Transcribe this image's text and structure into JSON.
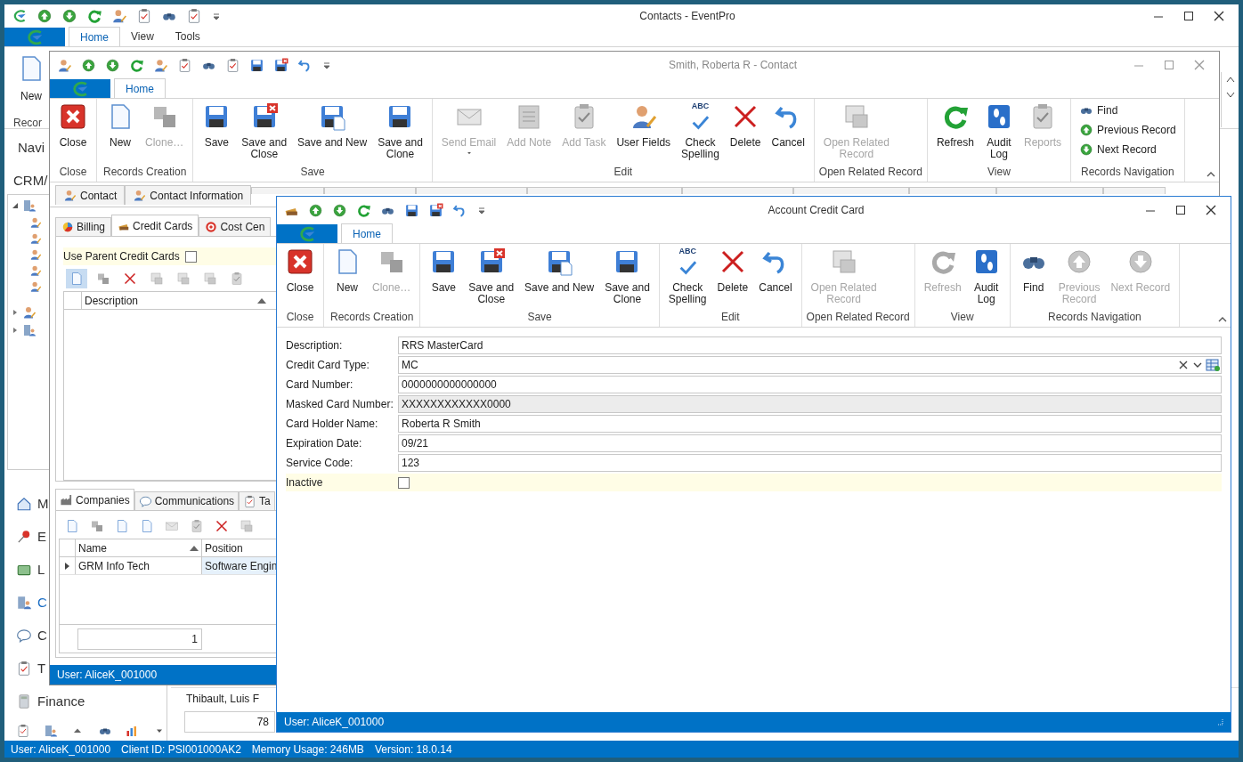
{
  "main": {
    "title": "Contacts - EventPro",
    "tabs": [
      {
        "label": "Home",
        "selected": true
      },
      {
        "label": "View",
        "selected": false
      },
      {
        "label": "Tools",
        "selected": false
      }
    ],
    "ribbon": {
      "button": "New",
      "group": "Recor"
    },
    "nav": {
      "title": "Navi",
      "section": "CRM/",
      "items": [
        {
          "label": "M",
          "kind": "home",
          "selected": false
        },
        {
          "label": "E",
          "kind": "pin",
          "selected": false
        },
        {
          "label": "L",
          "kind": "bed",
          "selected": false
        },
        {
          "label": "C",
          "kind": "building",
          "selected": true
        },
        {
          "label": "C",
          "kind": "bubble",
          "selected": false
        },
        {
          "label": "T",
          "kind": "task",
          "selected": false
        },
        {
          "label": "Finance",
          "kind": "calculator",
          "selected": false
        }
      ]
    },
    "grid": {
      "row": "Thibault, Luis F",
      "footer": "78"
    },
    "status": [
      "User: AliceK_001000",
      "Client ID: PSI001000AK2",
      "Memory Usage: 246MB",
      "Version: 18.0.14"
    ]
  },
  "contact": {
    "title": "Smith, Roberta R - Contact",
    "tabs": [
      {
        "label": "Home",
        "selected": true
      }
    ],
    "ribbon": [
      {
        "label": "Close",
        "kind": "large",
        "buttons": [
          {
            "label": "Close",
            "kind": "close",
            "disabled": false
          }
        ]
      },
      {
        "label": "Records Creation",
        "kind": "large",
        "buttons": [
          {
            "label": "New",
            "kind": "new",
            "disabled": false
          },
          {
            "label": "Clone…",
            "kind": "clone",
            "disabled": true
          }
        ]
      },
      {
        "label": "Save",
        "kind": "large",
        "buttons": [
          {
            "label": "Save",
            "kind": "save",
            "disabled": false
          },
          {
            "label": "Save and\nClose",
            "kind": "save-close",
            "disabled": false
          },
          {
            "label": "Save and New",
            "kind": "save-new",
            "disabled": false
          },
          {
            "label": "Save and\nClone",
            "kind": "save",
            "disabled": false
          }
        ]
      },
      {
        "label": "Edit",
        "kind": "large",
        "buttons": [
          {
            "label": "Send Email",
            "kind": "email",
            "disabled": true,
            "dropdown": true
          },
          {
            "label": "Add Note",
            "kind": "note",
            "disabled": true
          },
          {
            "label": "Add Task",
            "kind": "task",
            "disabled": true
          },
          {
            "label": "User Fields",
            "kind": "user",
            "disabled": false
          },
          {
            "label": "Check\nSpelling",
            "kind": "spell",
            "disabled": false,
            "icon_text": "ABC"
          },
          {
            "label": "Delete",
            "kind": "delete",
            "disabled": false
          },
          {
            "label": "Cancel",
            "kind": "cancel",
            "disabled": false
          }
        ]
      },
      {
        "label": "Open Related Record",
        "kind": "large",
        "buttons": [
          {
            "label": "Open Related\nRecord",
            "kind": "related",
            "disabled": true
          }
        ]
      },
      {
        "label": "View",
        "kind": "large",
        "buttons": [
          {
            "label": "Refresh",
            "kind": "refresh",
            "disabled": false
          },
          {
            "label": "Audit\nLog",
            "kind": "audit",
            "disabled": false
          },
          {
            "label": "Reports",
            "kind": "reports",
            "disabled": true
          }
        ]
      },
      {
        "label": "Records Navigation",
        "kind": "list",
        "buttons": [
          {
            "label": "Find",
            "kind": "find",
            "disabled": false
          },
          {
            "label": "Previous Record",
            "kind": "up",
            "disabled": false
          },
          {
            "label": "Next Record",
            "kind": "down",
            "disabled": false
          }
        ]
      }
    ],
    "record_tabs": [
      {
        "label": "Contact",
        "selected": false
      },
      {
        "label": "Contact Information",
        "selected": false
      }
    ],
    "sub_tabs": [
      {
        "label": "Billing",
        "kind": "pie",
        "selected": false
      },
      {
        "label": "Credit Cards",
        "kind": "cards",
        "selected": true
      },
      {
        "label": "Cost Cen",
        "kind": "target",
        "selected": false
      }
    ],
    "use_parent": {
      "label": "Use Parent Credit Cards",
      "checked": false
    },
    "cards_grid": {
      "columns": [
        "Description"
      ]
    },
    "lower_tabs": [
      {
        "label": "Companies",
        "kind": "factory",
        "selected": true
      },
      {
        "label": "Communications",
        "kind": "bubble",
        "selected": false
      },
      {
        "label": "Ta",
        "kind": "task",
        "selected": false
      }
    ],
    "companies_grid": {
      "columns": [
        "Name",
        "Position"
      ],
      "rows": [
        [
          "GRM Info Tech",
          "Software Engin"
        ]
      ],
      "footer": "1"
    },
    "status": "User: AliceK_001000"
  },
  "card": {
    "title": "Account Credit Card",
    "tabs": [
      {
        "label": "Home",
        "selected": true
      }
    ],
    "ribbon": [
      {
        "label": "Close",
        "kind": "large",
        "buttons": [
          {
            "label": "Close",
            "kind": "close",
            "disabled": false
          }
        ]
      },
      {
        "label": "Records Creation",
        "kind": "large",
        "buttons": [
          {
            "label": "New",
            "kind": "new",
            "disabled": false
          },
          {
            "label": "Clone…",
            "kind": "clone",
            "disabled": true
          }
        ]
      },
      {
        "label": "Save",
        "kind": "large",
        "buttons": [
          {
            "label": "Save",
            "kind": "save",
            "disabled": false
          },
          {
            "label": "Save and\nClose",
            "kind": "save-close",
            "disabled": false
          },
          {
            "label": "Save and New",
            "kind": "save-new",
            "disabled": false
          },
          {
            "label": "Save and\nClone",
            "kind": "save",
            "disabled": false
          }
        ]
      },
      {
        "label": "Edit",
        "kind": "large",
        "buttons": [
          {
            "label": "Check\nSpelling",
            "kind": "spell",
            "disabled": false,
            "icon_text": "ABC"
          },
          {
            "label": "Delete",
            "kind": "delete",
            "disabled": false
          },
          {
            "label": "Cancel",
            "kind": "cancel",
            "disabled": false
          }
        ]
      },
      {
        "label": "Open Related Record",
        "kind": "large",
        "buttons": [
          {
            "label": "Open Related\nRecord",
            "kind": "related",
            "disabled": true
          }
        ]
      },
      {
        "label": "View",
        "kind": "large",
        "buttons": [
          {
            "label": "Refresh",
            "kind": "refresh",
            "disabled": true
          },
          {
            "label": "Audit\nLog",
            "kind": "audit",
            "disabled": false
          }
        ]
      },
      {
        "label": "Records Navigation",
        "kind": "large",
        "buttons": [
          {
            "label": "Find",
            "kind": "find",
            "disabled": false
          },
          {
            "label": "Previous\nRecord",
            "kind": "up",
            "disabled": true
          },
          {
            "label": "Next Record",
            "kind": "down",
            "disabled": true
          }
        ]
      }
    ],
    "fields": [
      {
        "label": "Description:",
        "value": "RRS MasterCard",
        "kind": "text"
      },
      {
        "label": "Credit Card Type:",
        "value": "MC",
        "kind": "combo"
      },
      {
        "label": "Card Number:",
        "value": "0000000000000000",
        "kind": "text"
      },
      {
        "label": "Masked Card Number:",
        "value": "XXXXXXXXXXXX0000",
        "kind": "readonly"
      },
      {
        "label": "Card Holder Name:",
        "value": "Roberta R Smith",
        "kind": "text"
      },
      {
        "label": "Expiration Date:",
        "value": "09/21",
        "kind": "text"
      },
      {
        "label": "Service Code:",
        "value": "123",
        "kind": "text"
      },
      {
        "label": "Inactive",
        "kind": "checkbox",
        "checked": false
      }
    ],
    "status": "User: AliceK_001000"
  }
}
